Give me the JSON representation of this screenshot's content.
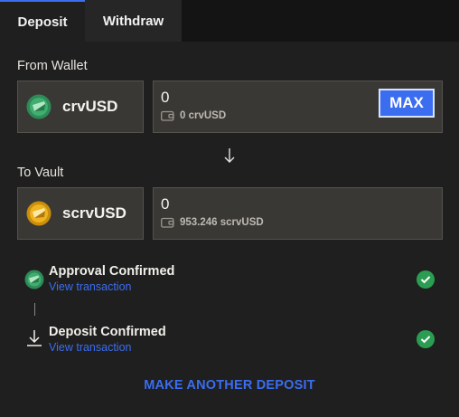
{
  "tabs": [
    {
      "label": "Deposit",
      "active": true
    },
    {
      "label": "Withdraw",
      "active": false
    }
  ],
  "from": {
    "label": "From Wallet",
    "token": "crvUSD",
    "token_icon": "crvusd-coin-icon",
    "amount": "0",
    "balance": "0 crvUSD",
    "max_label": "MAX"
  },
  "to": {
    "label": "To Vault",
    "token": "scrvUSD",
    "token_icon": "scrvusd-coin-icon",
    "amount": "0",
    "balance": "953.246 scrvUSD"
  },
  "steps": [
    {
      "title": "Approval Confirmed",
      "link": "View transaction",
      "icon": "crvusd-coin-icon",
      "status": "confirmed"
    },
    {
      "title": "Deposit Confirmed",
      "link": "View transaction",
      "icon": "download-arrow-icon",
      "status": "confirmed"
    }
  ],
  "make_another": "MAKE ANOTHER DEPOSIT",
  "colors": {
    "accent": "#3b6df0",
    "success": "#2a9d52",
    "crvusd_green": "#2e8b57",
    "scrvusd_gold": "#e0a412",
    "background": "#1f1f1f",
    "field": "#3a3835"
  }
}
